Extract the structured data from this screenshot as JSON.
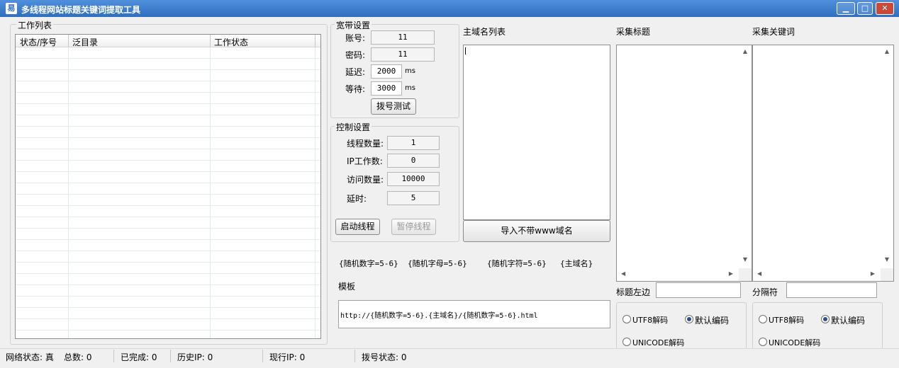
{
  "window": {
    "title": "多线程网站标题关键词提取工具",
    "minimize": "▁",
    "maximize": "□",
    "close": "✕",
    "icon": "app-logo-icon"
  },
  "work_list": {
    "group_label": "工作列表",
    "columns": [
      "状态/序号",
      "泛目录",
      "工作状态"
    ]
  },
  "broadband": {
    "group_label": "宽带设置",
    "account_label": "账号:",
    "account_value": "11",
    "password_label": "密码:",
    "password_value": "11",
    "delay_label": "延迟:",
    "delay_value": "2000",
    "delay_unit": "ms",
    "wait_label": "等待:",
    "wait_value": "3000",
    "wait_unit": "ms",
    "dial_test_button": "拨号测试"
  },
  "control": {
    "group_label": "控制设置",
    "threads_label": "线程数量:",
    "threads_value": "1",
    "ip_work_label": "IP工作数:",
    "ip_work_value": "0",
    "visits_label": "访问数量:",
    "visits_value": "10000",
    "timeout_label": "延时:",
    "timeout_value": "5",
    "start_button": "启动线程",
    "pause_button": "暂停线程"
  },
  "domain_list": {
    "label": "主域名列表",
    "import_button": "导入不带www域名"
  },
  "tokens": [
    "{随机数字=5-6}",
    "{随机字母=5-6}",
    "{随机字符=5-6}",
    "{主域名}"
  ],
  "template": {
    "label": "模板",
    "value": "http://{随机数字=5-6}.{主域名}/{随机数字=5-6}.html"
  },
  "collect_title": {
    "label": "采集标题",
    "left_label": "标题左边",
    "radio_utf8": "UTF8解码",
    "radio_default": "默认编码",
    "radio_unicode": "UNICODE解码"
  },
  "collect_keywords": {
    "label": "采集关键词",
    "separator_label": "分隔符",
    "radio_utf8": "UTF8解码",
    "radio_default": "默认编码",
    "radio_unicode": "UNICODE解码"
  },
  "statusbar": {
    "network": "网络状态: 真",
    "total": "总数: 0",
    "done": "已完成: 0",
    "history_ip": "历史IP: 0",
    "current_ip": "现行IP: 0",
    "dial_status": "拨号状态: 0"
  }
}
